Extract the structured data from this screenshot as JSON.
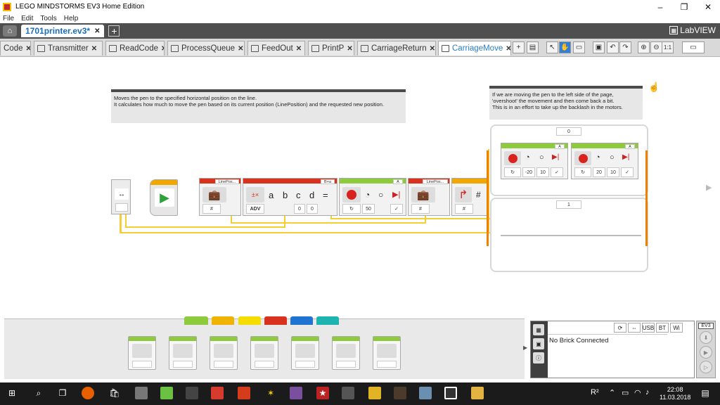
{
  "window": {
    "title": "LEGO MINDSTORMS EV3 Home Edition",
    "minimize": "–",
    "restore": "❐",
    "close": "✕"
  },
  "menu": [
    "File",
    "Edit",
    "Tools",
    "Help"
  ],
  "project": {
    "tab_name": "1701printer.ev3*",
    "close": "✕",
    "add": "+",
    "brand": "LabVIEW"
  },
  "program_tabs": [
    {
      "label": "Code"
    },
    {
      "label": "Transmitter"
    },
    {
      "label": "ReadCode"
    },
    {
      "label": "ProcessQueue"
    },
    {
      "label": "FeedOut"
    },
    {
      "label": "PrintP"
    },
    {
      "label": "CarriageReturn"
    },
    {
      "label": "CarriageMove",
      "active": true
    }
  ],
  "tab_close": "✕",
  "toolbar": {
    "add": "+",
    "zoom_level": "1:1"
  },
  "comments": [
    "Moves the pen to the specified horizontal position on the line.\nIt calculates how much to move the pen based on its current position (LinePosition) and the requested new position.",
    "If we are moving the pen to the left side of the page, 'overshoot' the movement and then come back a bit.\nThis is in an effort to take up the backlash in the motors."
  ],
  "blocks": {
    "var1_label": "LinePos...",
    "math_header": "B+a",
    "math_mode": "ADV",
    "math_inputs": [
      "a",
      "b",
      "c",
      "d",
      "="
    ],
    "math_vals": [
      "0",
      "0"
    ],
    "motor_header": "A",
    "motor_power": "50",
    "var2_label": "LinePos...",
    "hash": "#",
    "switch_case0": "0",
    "switch_case1": "1",
    "sub_motor_header": "A",
    "sub_motor1_vals": [
      "-20",
      "10"
    ],
    "sub_motor2_vals": [
      "20",
      "10"
    ]
  },
  "palette": {
    "tab_colors": [
      "#8ecb3c",
      "#f0b400",
      "#f5dd00",
      "#d8321e",
      "#1f74d1",
      "#1cb3b0"
    ]
  },
  "hardware": {
    "status": "No Brick Connected",
    "usb": "USB",
    "bt": "BT",
    "wifi": "Wi",
    "brick_label": "EV3",
    "brick_port": "2"
  },
  "taskbar": {
    "time": "22:08",
    "date": "11.03.2018",
    "tray_label": "R²"
  }
}
